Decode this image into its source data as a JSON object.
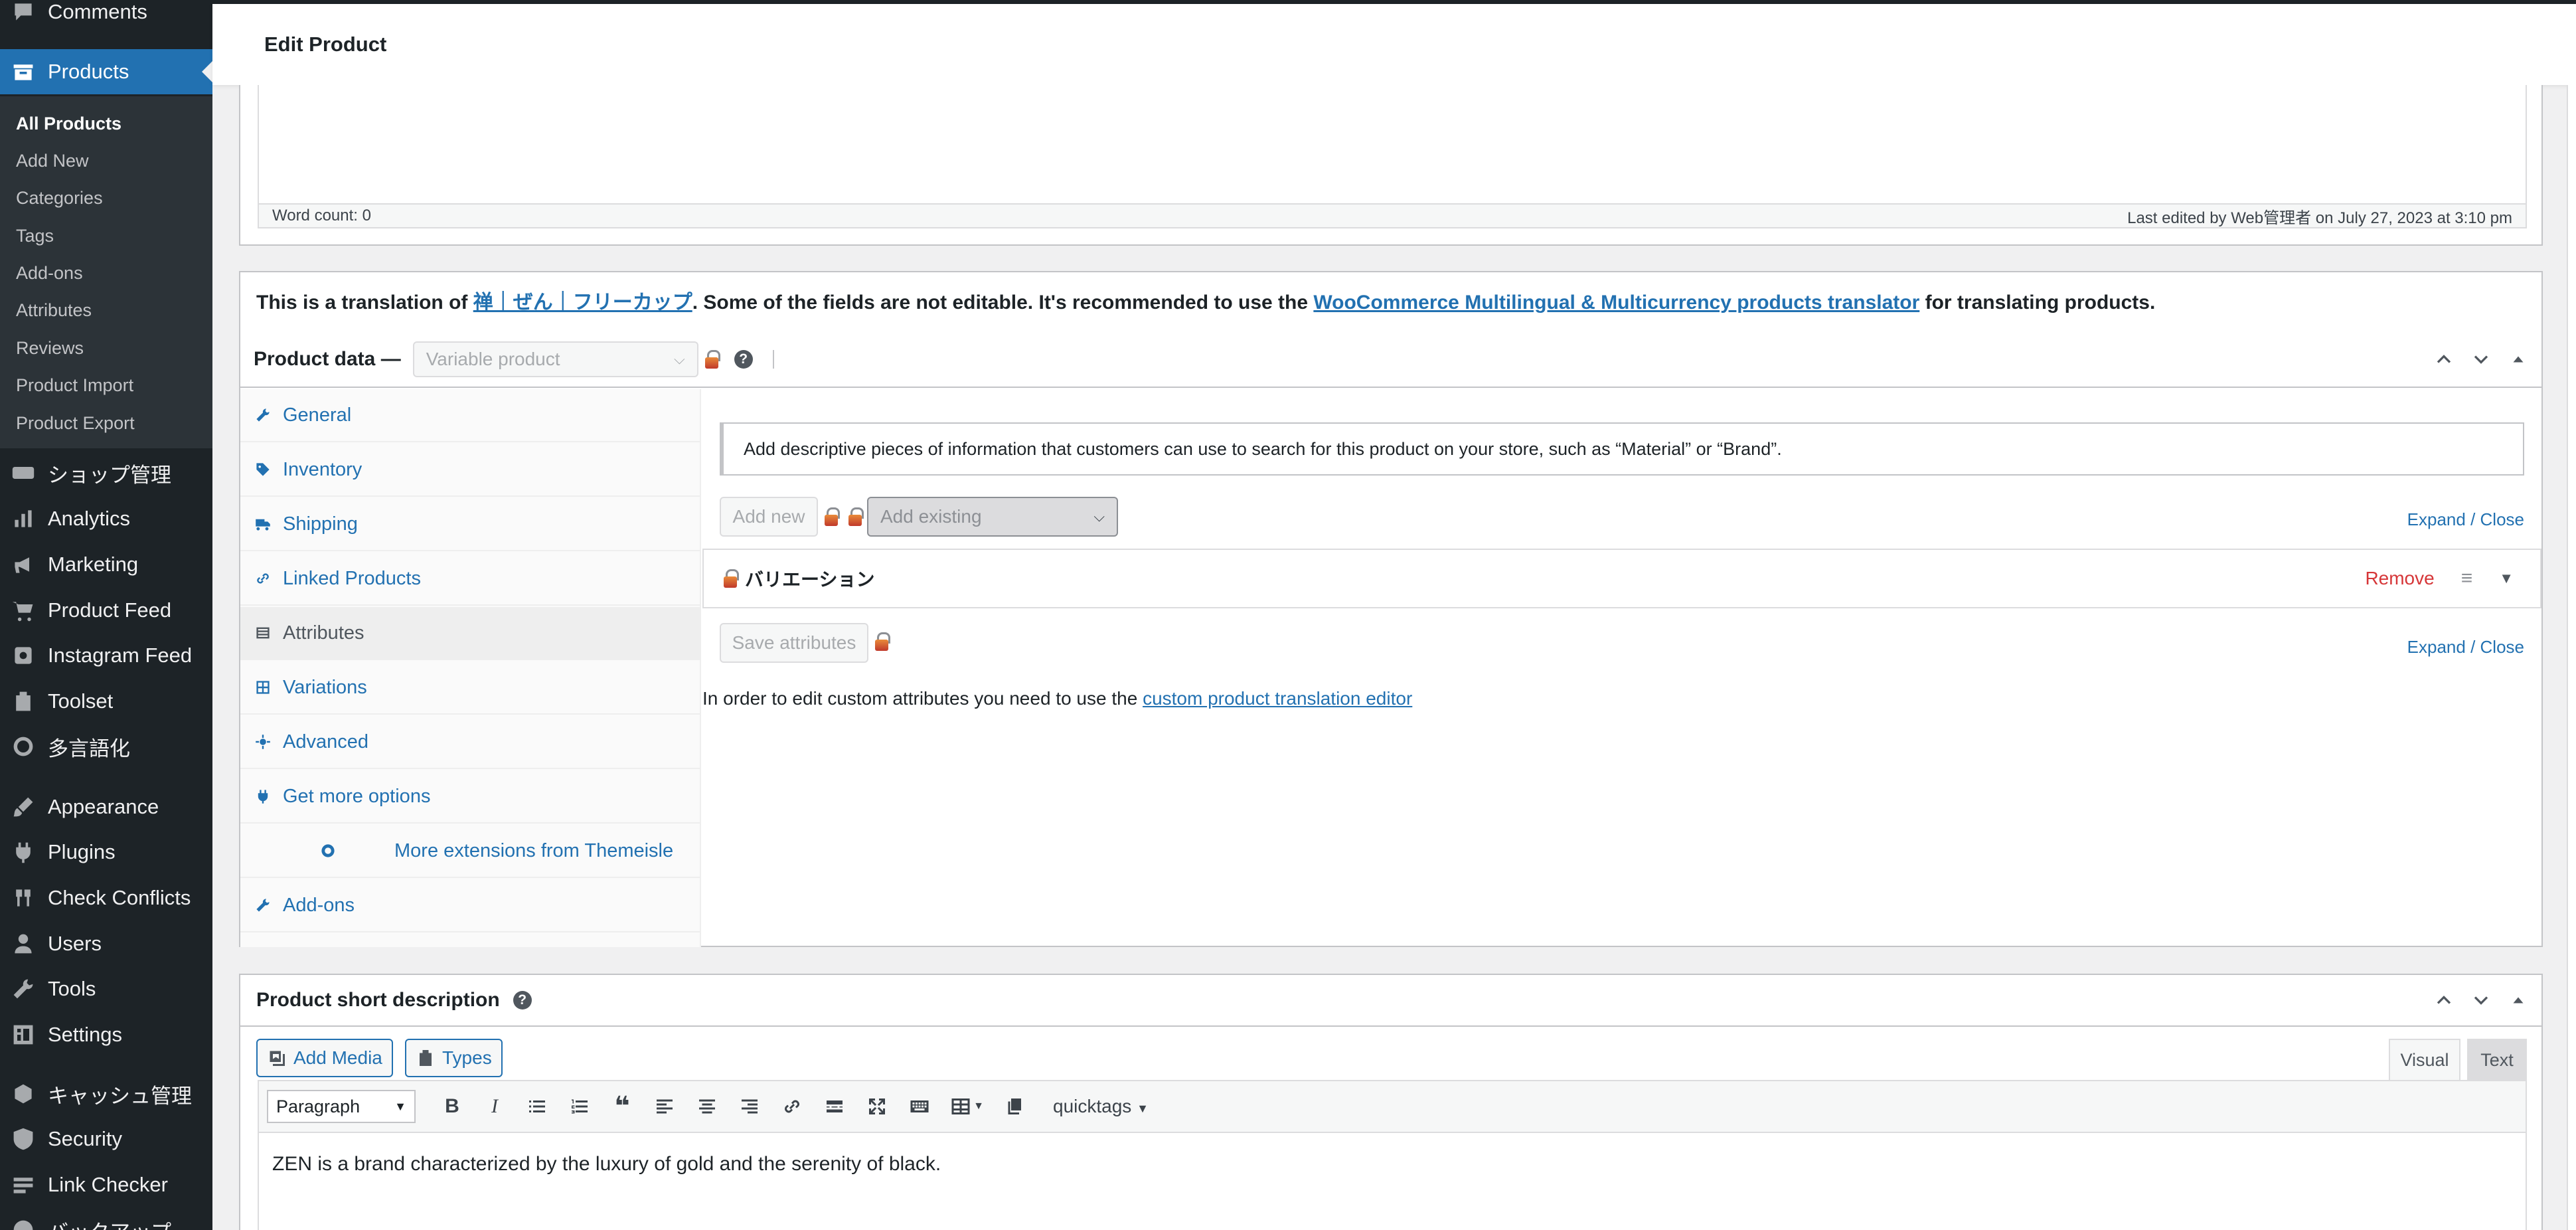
{
  "sidebar": {
    "comments": "Comments",
    "products": "Products",
    "submenu": [
      "All Products",
      "Add New",
      "Categories",
      "Tags",
      "Add-ons",
      "Attributes",
      "Reviews",
      "Product Import",
      "Product Export"
    ],
    "shop": "ショップ管理",
    "analytics": "Analytics",
    "marketing": "Marketing",
    "product_feed": "Product Feed",
    "instagram_feed": "Instagram Feed",
    "toolset": "Toolset",
    "multilang": "多言語化",
    "appearance": "Appearance",
    "plugins": "Plugins",
    "check_conflicts": "Check Conflicts",
    "users": "Users",
    "tools": "Tools",
    "settings": "Settings",
    "cache": "キャッシュ管理",
    "security": "Security",
    "link_checker": "Link Checker",
    "backup": "バックアップ"
  },
  "header": {
    "title": "Edit Product"
  },
  "editor": {
    "word_count": "Word count: 0",
    "last_edited": "Last edited by Web管理者 on July 27, 2023 at 3:10 pm"
  },
  "translation": {
    "prefix": "This is a translation of ",
    "source_link": "禅｜ぜん｜フリーカップ",
    "middle": ". Some of the fields are not editable. It's recommended to use the ",
    "translator_link": "WooCommerce Multilingual & Multicurrency products translator",
    "suffix": " for translating products."
  },
  "product_data": {
    "label": "Product data —",
    "type_value": "Variable product",
    "help": "?"
  },
  "tabs": [
    "General",
    "Inventory",
    "Shipping",
    "Linked Products",
    "Attributes",
    "Variations",
    "Advanced",
    "Get more options",
    "More extensions from Themeisle",
    "Add-ons"
  ],
  "attributes": {
    "notice": "Add descriptive pieces of information that customers can use to search for this product on your store, such as “Material” or “Brand”.",
    "add_new": "Add new",
    "add_existing": "Add existing",
    "expand": "Expand",
    "slash": " / ",
    "close": "Close",
    "attribute_name": "バリエーション",
    "remove": "Remove",
    "save": "Save attributes",
    "custom_note_prefix": "In order to edit custom attributes you need to use the ",
    "custom_note_link": "custom product translation editor"
  },
  "short_description": {
    "title": "Product short description",
    "add_media": "Add Media",
    "types": "Types",
    "visual": "Visual",
    "text": "Text",
    "format": "Paragraph",
    "quicktags": "quicktags",
    "content": "ZEN is a brand characterized by the luxury of gold and the serenity of black."
  },
  "colors": {
    "accent": "#2271b1",
    "sidebar": "#1d2327",
    "remove": "#d63638"
  }
}
